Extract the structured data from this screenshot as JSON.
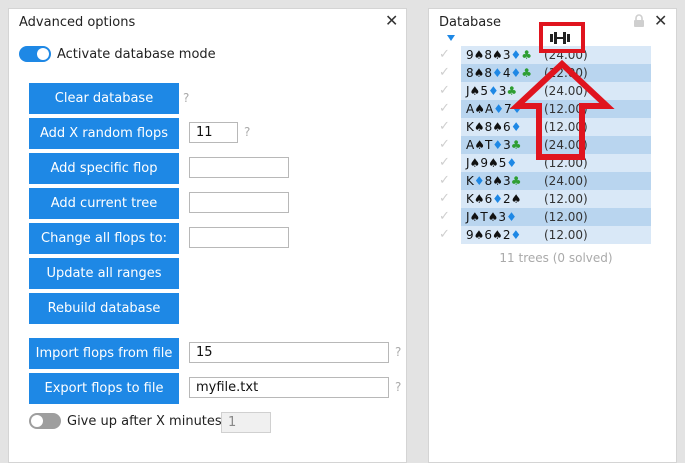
{
  "left_panel": {
    "title": "Advanced options",
    "activate_label": "Activate database mode",
    "buttons": {
      "clear": "Clear database",
      "add_random": "Add X random flops",
      "add_specific": "Add specific flop",
      "add_current": "Add current tree",
      "change_all": "Change all flops to:",
      "update_ranges": "Update all ranges",
      "rebuild": "Rebuild database",
      "import": "Import flops from file",
      "export": "Export flops to file"
    },
    "inputs": {
      "random_count": "11",
      "specific_flop": "",
      "current_tree": "",
      "change_all": "",
      "import_value": "15",
      "export_value": "myfile.txt",
      "give_up_minutes": "1"
    },
    "give_up_label": "Give up after X minutes:",
    "help": "?"
  },
  "right_panel": {
    "title": "Database",
    "rows": [
      {
        "cards": [
          [
            "9",
            "s"
          ],
          [
            "8",
            "s"
          ],
          [
            "3",
            "d"
          ],
          [
            "",
            "c"
          ]
        ],
        "weight": "(24.00)"
      },
      {
        "cards": [
          [
            "8",
            "s"
          ],
          [
            "8",
            "d"
          ],
          [
            "4",
            "d"
          ],
          [
            "",
            "c"
          ]
        ],
        "weight": "(12.00)"
      },
      {
        "cards": [
          [
            "J",
            "s"
          ],
          [
            "5",
            "d"
          ],
          [
            "3",
            "c"
          ]
        ],
        "weight": "(24.00)"
      },
      {
        "cards": [
          [
            "A",
            "s"
          ],
          [
            "A",
            "d"
          ],
          [
            "7",
            "d"
          ]
        ],
        "weight": "(12.00)"
      },
      {
        "cards": [
          [
            "K",
            "s"
          ],
          [
            "8",
            "s"
          ],
          [
            "6",
            "d"
          ]
        ],
        "weight": "(12.00)"
      },
      {
        "cards": [
          [
            "A",
            "s"
          ],
          [
            "T",
            "d"
          ],
          [
            "3",
            "c"
          ]
        ],
        "weight": "(24.00)"
      },
      {
        "cards": [
          [
            "J",
            "s"
          ],
          [
            "9",
            "s"
          ],
          [
            "5",
            "d"
          ]
        ],
        "weight": "(12.00)"
      },
      {
        "cards": [
          [
            "K",
            "d"
          ],
          [
            "8",
            "s"
          ],
          [
            "3",
            "c"
          ]
        ],
        "weight": "(24.00)"
      },
      {
        "cards": [
          [
            "K",
            "s"
          ],
          [
            "6",
            "d"
          ],
          [
            "2",
            "s"
          ]
        ],
        "weight": "(12.00)"
      },
      {
        "cards": [
          [
            "J",
            "s"
          ],
          [
            "T",
            "s"
          ],
          [
            "3",
            "d"
          ]
        ],
        "weight": "(12.00)"
      },
      {
        "cards": [
          [
            "9",
            "s"
          ],
          [
            "6",
            "s"
          ],
          [
            "2",
            "d"
          ]
        ],
        "weight": "(12.00)"
      }
    ],
    "footer": "11 trees (0 solved)"
  },
  "colors": {
    "accent": "#1e88e5",
    "row_dark": "#b9d5ef",
    "row_light": "#d9e8f7",
    "highlight_red": "#e0141e"
  },
  "icons": {
    "close": "close-icon",
    "lock": "lock-icon",
    "sort": "sort-arrow-icon",
    "weight": "dumbbell-icon",
    "check": "checkmark-icon"
  }
}
